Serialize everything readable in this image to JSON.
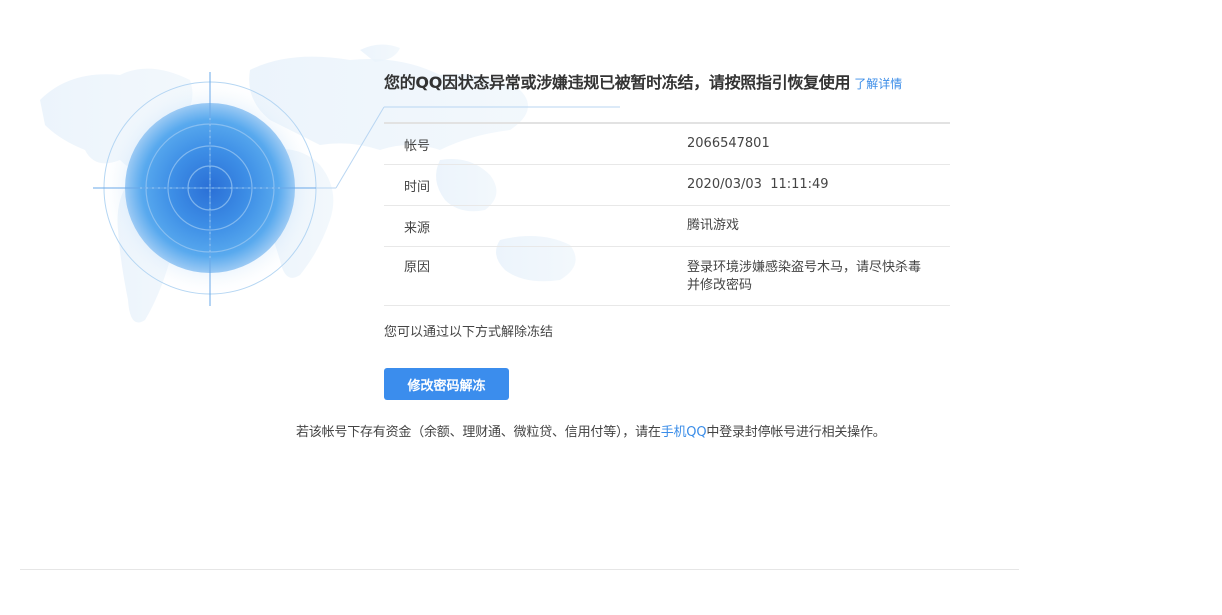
{
  "notice": {
    "title": "您的QQ因状态异常或涉嫌违规已被暂时冻结，请按照指引恢复使用",
    "detail_link": "了解详情"
  },
  "info_rows": [
    {
      "label": "帐号",
      "value": "2066547801"
    },
    {
      "label": "时间",
      "value": "2020/03/03  11:11:49"
    },
    {
      "label": "来源",
      "value": "腾讯游戏"
    },
    {
      "label": "原因",
      "value": "登录环境涉嫌感染盗号木马，请尽快杀毒并修改密码"
    }
  ],
  "unfreeze_hint": "您可以通过以下方式解除冻结",
  "unfreeze_button": "修改密码解冻",
  "funds_notice": {
    "prefix": "若该帐号下存有资金（余额、理财通、微粒贷、信用付等），请在",
    "link": "手机QQ",
    "suffix": "中登录封停帐号进行相关操作。"
  },
  "colors": {
    "accent": "#3b8ded",
    "link": "#3b8de8",
    "globe_center": "#2f7fe0",
    "globe_edge": "#8fc3f5"
  },
  "icons": {
    "illustration": "world-map-radar-globe"
  }
}
